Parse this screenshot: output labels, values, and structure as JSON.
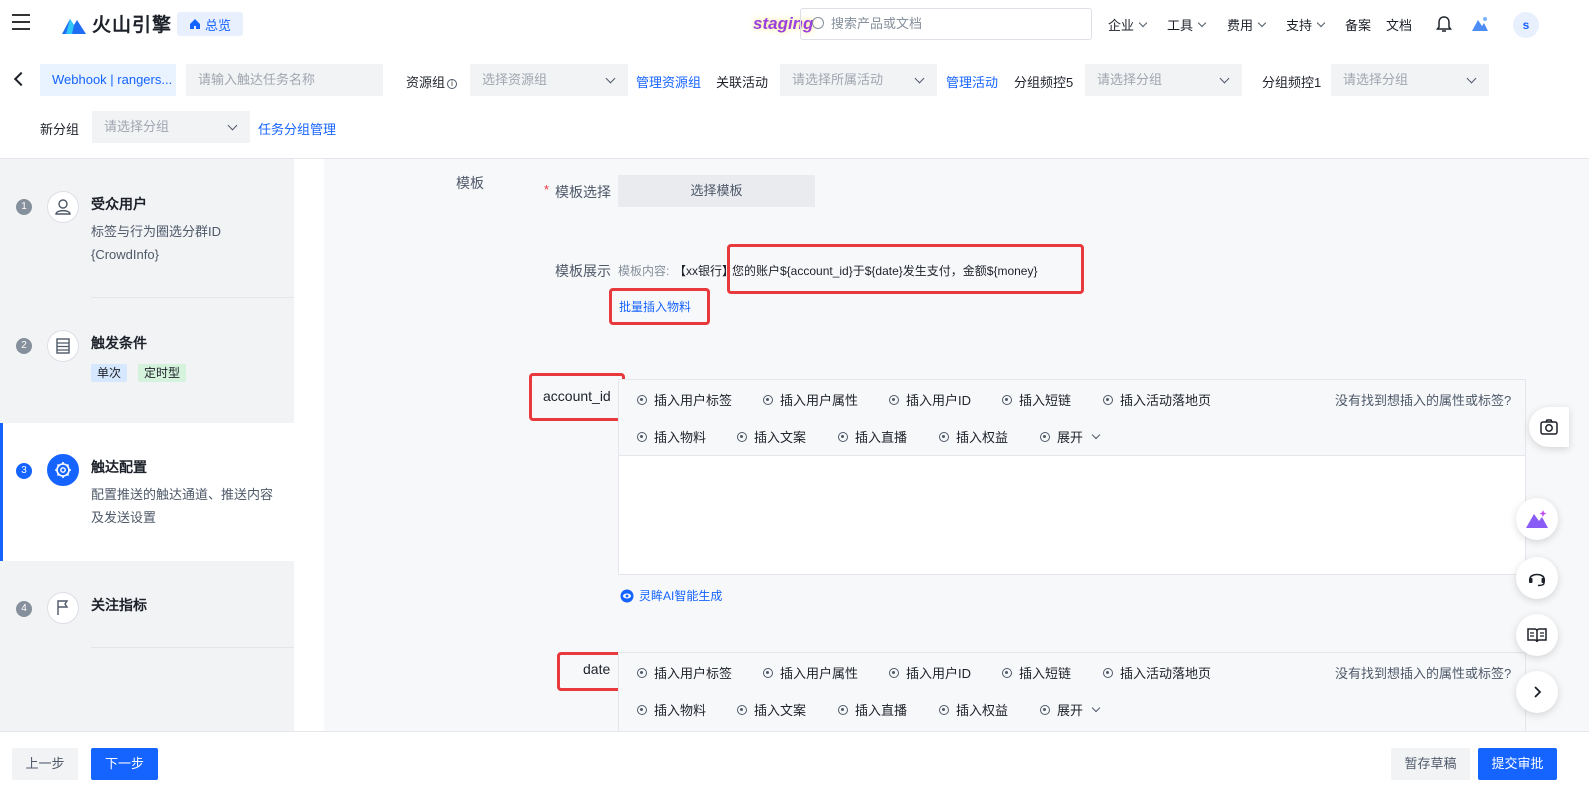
{
  "topbar": {
    "brand": "火山引擎",
    "overview": "总览",
    "staging": "staging",
    "search_placeholder": "搜索产品或文档",
    "nav": [
      "企业",
      "工具",
      "费用",
      "支持"
    ],
    "nav_plain": [
      "备案",
      "文档"
    ],
    "avatar": "s"
  },
  "filters": {
    "task_tag": "Webhook | rangers...",
    "task_name_placeholder": "请输入触达任务名称",
    "resource_group_label": "资源组",
    "resource_group_placeholder": "选择资源组",
    "manage_resource_group": "管理资源组",
    "related_activity_label": "关联活动",
    "related_activity_placeholder": "请选择所属活动",
    "manage_activity": "管理活动",
    "group_freq5_label": "分组频控5",
    "group_freq5_placeholder": "请选择分组",
    "group_freq1_label": "分组频控1",
    "group_freq1_placeholder": "请选择分组",
    "new_group_label": "新分组",
    "new_group_placeholder": "请选择分组",
    "task_group_manage": "任务分组管理"
  },
  "steps": [
    {
      "num": "1",
      "title": "受众用户",
      "desc1": "标签与行为圈选分群ID",
      "desc2": "{CrowdInfo}"
    },
    {
      "num": "2",
      "title": "触发条件",
      "badge1": "单次",
      "badge2": "定时型"
    },
    {
      "num": "3",
      "title": "触达配置",
      "desc1": "配置推送的触达通道、推送内容",
      "desc2": "及发送设置"
    },
    {
      "num": "4",
      "title": "关注指标"
    }
  ],
  "form": {
    "section_label": "模板",
    "template_select_label": "模板选择",
    "required_mark": "*",
    "template_select_button": "选择模板",
    "template_display_label": "模板展示",
    "template_content_prefix": "模板内容:",
    "template_content_bank": "【xx银行】",
    "template_content_body": "您的账户${account_id}于${date}发生支付，金额${money}",
    "batch_insert": "批量插入物料",
    "var1": "account_id",
    "var2": "date",
    "ai_generate": "灵眸AI智能生成",
    "toolbar_row1": [
      "插入用户标签",
      "插入用户属性",
      "插入用户ID",
      "插入短链",
      "插入活动落地页"
    ],
    "toolbar_row2": [
      "插入物料",
      "插入文案",
      "插入直播",
      "插入权益"
    ],
    "expand": "展开",
    "not_found": "没有找到想插入的属性或标签?"
  },
  "bottom": {
    "prev": "上一步",
    "next": "下一步",
    "save_draft": "暂存草稿",
    "submit": "提交审批"
  },
  "colors": {
    "primary": "#1664ff",
    "highlight_border": "#e8393d"
  }
}
